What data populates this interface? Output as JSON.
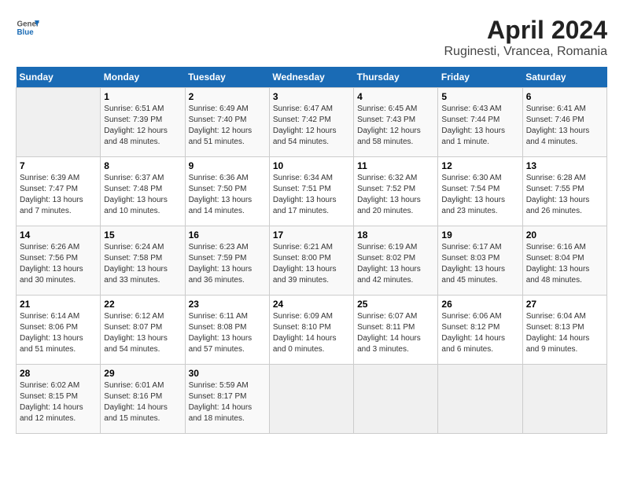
{
  "header": {
    "logo_line1": "General",
    "logo_line2": "Blue",
    "title": "April 2024",
    "subtitle": "Ruginesti, Vrancea, Romania"
  },
  "days_of_week": [
    "Sunday",
    "Monday",
    "Tuesday",
    "Wednesday",
    "Thursday",
    "Friday",
    "Saturday"
  ],
  "weeks": [
    [
      {
        "day": "",
        "sunrise": "",
        "sunset": "",
        "daylight": "",
        "empty": true
      },
      {
        "day": "1",
        "sunrise": "Sunrise: 6:51 AM",
        "sunset": "Sunset: 7:39 PM",
        "daylight": "Daylight: 12 hours and 48 minutes."
      },
      {
        "day": "2",
        "sunrise": "Sunrise: 6:49 AM",
        "sunset": "Sunset: 7:40 PM",
        "daylight": "Daylight: 12 hours and 51 minutes."
      },
      {
        "day": "3",
        "sunrise": "Sunrise: 6:47 AM",
        "sunset": "Sunset: 7:42 PM",
        "daylight": "Daylight: 12 hours and 54 minutes."
      },
      {
        "day": "4",
        "sunrise": "Sunrise: 6:45 AM",
        "sunset": "Sunset: 7:43 PM",
        "daylight": "Daylight: 12 hours and 58 minutes."
      },
      {
        "day": "5",
        "sunrise": "Sunrise: 6:43 AM",
        "sunset": "Sunset: 7:44 PM",
        "daylight": "Daylight: 13 hours and 1 minute."
      },
      {
        "day": "6",
        "sunrise": "Sunrise: 6:41 AM",
        "sunset": "Sunset: 7:46 PM",
        "daylight": "Daylight: 13 hours and 4 minutes."
      }
    ],
    [
      {
        "day": "7",
        "sunrise": "Sunrise: 6:39 AM",
        "sunset": "Sunset: 7:47 PM",
        "daylight": "Daylight: 13 hours and 7 minutes."
      },
      {
        "day": "8",
        "sunrise": "Sunrise: 6:37 AM",
        "sunset": "Sunset: 7:48 PM",
        "daylight": "Daylight: 13 hours and 10 minutes."
      },
      {
        "day": "9",
        "sunrise": "Sunrise: 6:36 AM",
        "sunset": "Sunset: 7:50 PM",
        "daylight": "Daylight: 13 hours and 14 minutes."
      },
      {
        "day": "10",
        "sunrise": "Sunrise: 6:34 AM",
        "sunset": "Sunset: 7:51 PM",
        "daylight": "Daylight: 13 hours and 17 minutes."
      },
      {
        "day": "11",
        "sunrise": "Sunrise: 6:32 AM",
        "sunset": "Sunset: 7:52 PM",
        "daylight": "Daylight: 13 hours and 20 minutes."
      },
      {
        "day": "12",
        "sunrise": "Sunrise: 6:30 AM",
        "sunset": "Sunset: 7:54 PM",
        "daylight": "Daylight: 13 hours and 23 minutes."
      },
      {
        "day": "13",
        "sunrise": "Sunrise: 6:28 AM",
        "sunset": "Sunset: 7:55 PM",
        "daylight": "Daylight: 13 hours and 26 minutes."
      }
    ],
    [
      {
        "day": "14",
        "sunrise": "Sunrise: 6:26 AM",
        "sunset": "Sunset: 7:56 PM",
        "daylight": "Daylight: 13 hours and 30 minutes."
      },
      {
        "day": "15",
        "sunrise": "Sunrise: 6:24 AM",
        "sunset": "Sunset: 7:58 PM",
        "daylight": "Daylight: 13 hours and 33 minutes."
      },
      {
        "day": "16",
        "sunrise": "Sunrise: 6:23 AM",
        "sunset": "Sunset: 7:59 PM",
        "daylight": "Daylight: 13 hours and 36 minutes."
      },
      {
        "day": "17",
        "sunrise": "Sunrise: 6:21 AM",
        "sunset": "Sunset: 8:00 PM",
        "daylight": "Daylight: 13 hours and 39 minutes."
      },
      {
        "day": "18",
        "sunrise": "Sunrise: 6:19 AM",
        "sunset": "Sunset: 8:02 PM",
        "daylight": "Daylight: 13 hours and 42 minutes."
      },
      {
        "day": "19",
        "sunrise": "Sunrise: 6:17 AM",
        "sunset": "Sunset: 8:03 PM",
        "daylight": "Daylight: 13 hours and 45 minutes."
      },
      {
        "day": "20",
        "sunrise": "Sunrise: 6:16 AM",
        "sunset": "Sunset: 8:04 PM",
        "daylight": "Daylight: 13 hours and 48 minutes."
      }
    ],
    [
      {
        "day": "21",
        "sunrise": "Sunrise: 6:14 AM",
        "sunset": "Sunset: 8:06 PM",
        "daylight": "Daylight: 13 hours and 51 minutes."
      },
      {
        "day": "22",
        "sunrise": "Sunrise: 6:12 AM",
        "sunset": "Sunset: 8:07 PM",
        "daylight": "Daylight: 13 hours and 54 minutes."
      },
      {
        "day": "23",
        "sunrise": "Sunrise: 6:11 AM",
        "sunset": "Sunset: 8:08 PM",
        "daylight": "Daylight: 13 hours and 57 minutes."
      },
      {
        "day": "24",
        "sunrise": "Sunrise: 6:09 AM",
        "sunset": "Sunset: 8:10 PM",
        "daylight": "Daylight: 14 hours and 0 minutes."
      },
      {
        "day": "25",
        "sunrise": "Sunrise: 6:07 AM",
        "sunset": "Sunset: 8:11 PM",
        "daylight": "Daylight: 14 hours and 3 minutes."
      },
      {
        "day": "26",
        "sunrise": "Sunrise: 6:06 AM",
        "sunset": "Sunset: 8:12 PM",
        "daylight": "Daylight: 14 hours and 6 minutes."
      },
      {
        "day": "27",
        "sunrise": "Sunrise: 6:04 AM",
        "sunset": "Sunset: 8:13 PM",
        "daylight": "Daylight: 14 hours and 9 minutes."
      }
    ],
    [
      {
        "day": "28",
        "sunrise": "Sunrise: 6:02 AM",
        "sunset": "Sunset: 8:15 PM",
        "daylight": "Daylight: 14 hours and 12 minutes."
      },
      {
        "day": "29",
        "sunrise": "Sunrise: 6:01 AM",
        "sunset": "Sunset: 8:16 PM",
        "daylight": "Daylight: 14 hours and 15 minutes."
      },
      {
        "day": "30",
        "sunrise": "Sunrise: 5:59 AM",
        "sunset": "Sunset: 8:17 PM",
        "daylight": "Daylight: 14 hours and 18 minutes."
      },
      {
        "day": "",
        "sunrise": "",
        "sunset": "",
        "daylight": "",
        "empty": true
      },
      {
        "day": "",
        "sunrise": "",
        "sunset": "",
        "daylight": "",
        "empty": true
      },
      {
        "day": "",
        "sunrise": "",
        "sunset": "",
        "daylight": "",
        "empty": true
      },
      {
        "day": "",
        "sunrise": "",
        "sunset": "",
        "daylight": "",
        "empty": true
      }
    ]
  ]
}
